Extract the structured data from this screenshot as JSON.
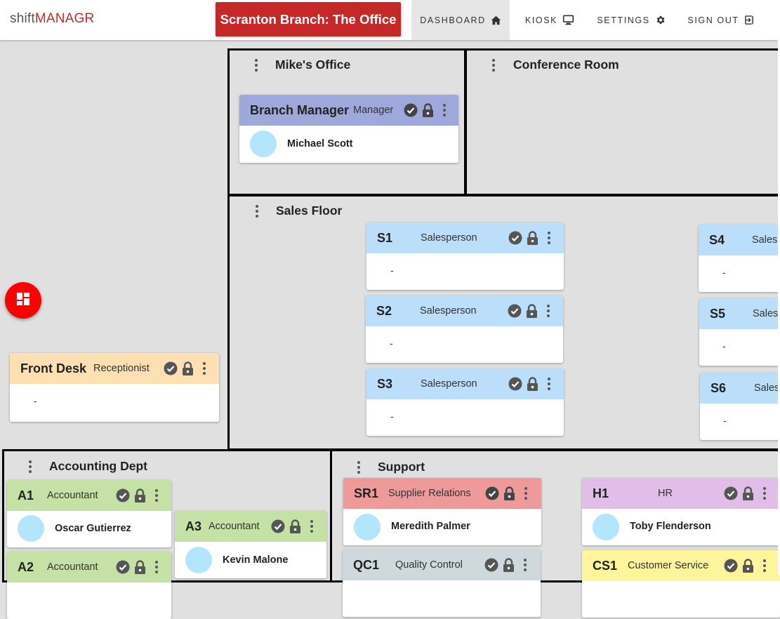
{
  "brand": {
    "part1": "shift",
    "part2": "MANAGR"
  },
  "branch_button": "Scranton Branch: The Office",
  "nav": {
    "dashboard": "DASHBOARD",
    "kiosk": "KIOSK",
    "settings": "SETTINGS",
    "signout": "SIGN OUT"
  },
  "colors": {
    "brand_red": "#c62828",
    "manager": "#9fa8da",
    "sales": "#bbdefb",
    "reception": "#ffe0b2",
    "accounting": "#c5e1a5",
    "supplier": "#ef9a9a",
    "hr": "#e1bee7",
    "quality": "#cfd8dc",
    "customer_service": "#fff59d"
  },
  "rooms": {
    "mikes_office": "Mike's Office",
    "conference_room": "Conference Room",
    "sales_floor": "Sales Floor",
    "accounting": "Accounting Dept",
    "support": "Support"
  },
  "empty_marker": "-",
  "cards": {
    "branch_manager": {
      "code": "Branch Manager",
      "role": "Manager",
      "person": "Michael Scott"
    },
    "front_desk": {
      "code": "Front Desk",
      "role": "Receptionist"
    },
    "s1": {
      "code": "S1",
      "role": "Salesperson"
    },
    "s2": {
      "code": "S2",
      "role": "Salesperson"
    },
    "s3": {
      "code": "S3",
      "role": "Salesperson"
    },
    "s4": {
      "code": "S4",
      "role": "Sales"
    },
    "s5": {
      "code": "S5",
      "role": "Sales"
    },
    "s6": {
      "code": "S6",
      "role": "Sales"
    },
    "a1": {
      "code": "A1",
      "role": "Accountant",
      "person": "Oscar Gutierrez"
    },
    "a2": {
      "code": "A2",
      "role": "Accountant"
    },
    "a3": {
      "code": "A3",
      "role": "Accountant",
      "person": "Kevin Malone"
    },
    "sr1": {
      "code": "SR1",
      "role": "Supplier Relations",
      "person": "Meredith Palmer"
    },
    "qc1": {
      "code": "QC1",
      "role": "Quality Control"
    },
    "h1": {
      "code": "H1",
      "role": "HR",
      "person": "Toby Flenderson"
    },
    "cs1": {
      "code": "CS1",
      "role": "Customer Service"
    }
  },
  "icons": {
    "home": "home-icon",
    "kiosk": "monitor-icon",
    "settings": "gear-icon",
    "signout": "exit-icon",
    "card_status": "check-circle-icon",
    "card_lock": "lock-icon",
    "menu": "kebab-menu-icon",
    "fab": "dashboard-grid-icon"
  }
}
